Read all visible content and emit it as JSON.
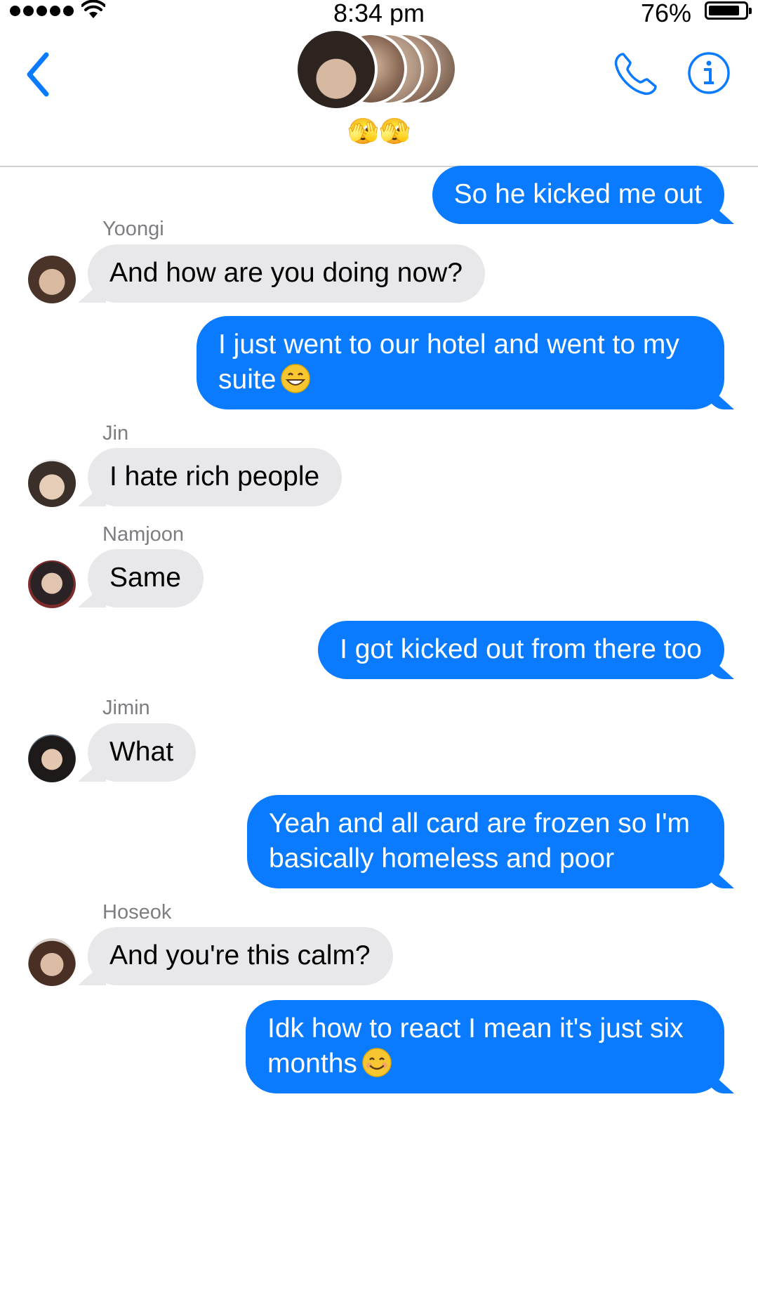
{
  "status_bar": {
    "time": "8:34 pm",
    "battery_percent": "76%",
    "battery_level": 0.76,
    "signal_dots": 5
  },
  "header": {
    "group_name": "🫣🫣",
    "back_icon": "chevron-left-icon",
    "call_icon": "phone-icon",
    "info_icon": "info-icon",
    "accent_color": "#0a7bff",
    "avatar_count": 5
  },
  "messages": [
    {
      "direction": "out",
      "text": "So he kicked me out"
    },
    {
      "direction": "in",
      "sender": "Yoongi",
      "text": "And how are you doing now?"
    },
    {
      "direction": "out",
      "line1": "I just went to our hotel and went to my",
      "line2": "suite",
      "emoji": "grinning-face"
    },
    {
      "direction": "in",
      "sender": "Jin",
      "text": "I hate rich people"
    },
    {
      "direction": "in",
      "sender": "Namjoon",
      "text": "Same"
    },
    {
      "direction": "out",
      "text": "I got kicked out from there too"
    },
    {
      "direction": "in",
      "sender": "Jimin",
      "text": "What"
    },
    {
      "direction": "out",
      "line1": "Yeah and all card are frozen so I'm",
      "line2": "basically homeless and poor"
    },
    {
      "direction": "in",
      "sender": "Hoseok",
      "text": "And you're this calm?"
    },
    {
      "direction": "out",
      "line1": "Idk how to react I mean it's just six",
      "line2": "months",
      "emoji": "smiling-face"
    }
  ],
  "colors": {
    "outgoing_bubble": "#0a7bff",
    "incoming_bubble": "#e8e8eb",
    "sender_name": "#7d7d82"
  }
}
